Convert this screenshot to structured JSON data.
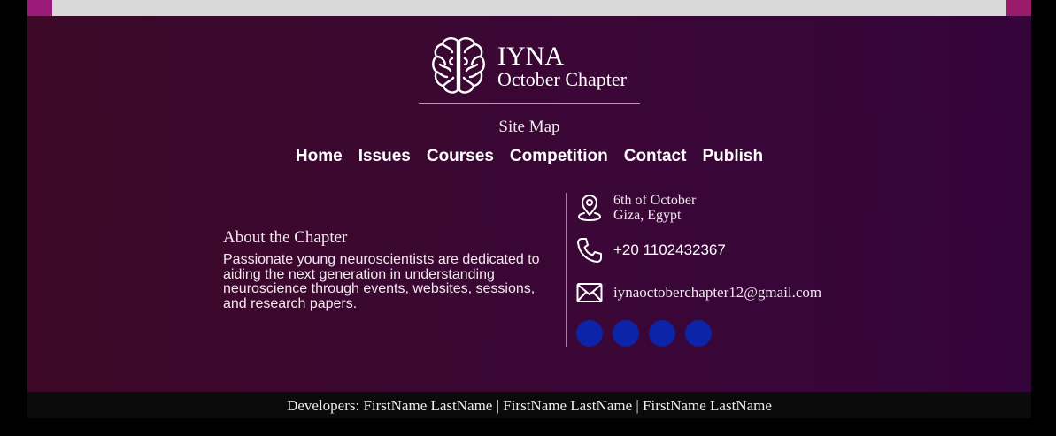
{
  "brand": {
    "title": "IYNA",
    "subtitle": "October Chapter",
    "logo_icon": "brain-icon"
  },
  "sitemap": {
    "title": "Site Map",
    "links": [
      "Home",
      "Issues",
      "Courses",
      "Competition",
      "Contact",
      "Publish"
    ]
  },
  "about": {
    "title": "About the Chapter",
    "text": "Passionate young neuroscientists are dedicated to aiding the next generation in understanding neuroscience through events, websites, sessions, and research papers."
  },
  "contact": {
    "location_line1": "6th of October",
    "location_line2": "Giza, Egypt",
    "phone": "+20 1102432367",
    "email": "iynaoctoberchapter12@gmail.com",
    "icons": [
      "location-pin-icon",
      "phone-icon",
      "mail-icon"
    ]
  },
  "socials": {
    "count": 4,
    "color": "#0b24a8"
  },
  "developers": "Developers: FirstName LastName | FirstName LastName | FirstName LastName",
  "colors": {
    "footer_start": "#3d0927",
    "footer_end": "#35043a",
    "accent": "#9b1a7a",
    "social": "#0b24a8"
  }
}
